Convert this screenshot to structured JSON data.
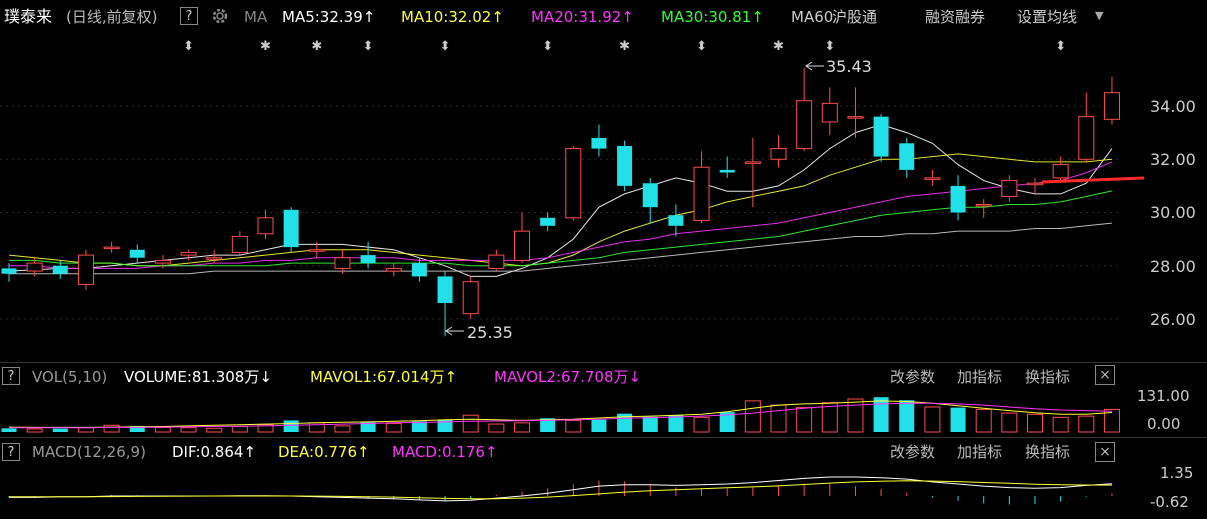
{
  "header": {
    "stock_name": "璞泰来",
    "period_desc": "(日线,前复权)",
    "help": "?",
    "ma_label": "MA",
    "indicators": [
      {
        "label": "MA5:32.39",
        "arrow": "↑",
        "color": "#ffffff"
      },
      {
        "label": "MA10:32.02",
        "arrow": "↑",
        "color": "#ffff33"
      },
      {
        "label": "MA20:31.92",
        "arrow": "↑",
        "color": "#ff33ff"
      },
      {
        "label": "MA30:30.81",
        "arrow": "↑",
        "color": "#33ff33"
      },
      {
        "label": "MA60:",
        "arrow": "",
        "color": "#cccccc"
      }
    ],
    "tabs": [
      "沪股通",
      "融资融券",
      "设置均线"
    ]
  },
  "price_axis": {
    "ticks": [
      "34.00",
      "32.00",
      "30.00",
      "28.00",
      "26.00"
    ]
  },
  "annotations": {
    "high": "35.43",
    "low": "25.35"
  },
  "volume_panel": {
    "help": "?",
    "title": "VOL(5,10)",
    "items": [
      {
        "label": "VOLUME:81.308万",
        "arrow": "↓",
        "color": "#ffffff"
      },
      {
        "label": "MAVOL1:67.014万",
        "arrow": "↑",
        "color": "#ffff33"
      },
      {
        "label": "MAVOL2:67.708万",
        "arrow": "↓",
        "color": "#ff33ff"
      }
    ],
    "actions": [
      "改参数",
      "加指标",
      "换指标"
    ],
    "close": "×",
    "axis": [
      "131.00",
      "0.00"
    ]
  },
  "macd_panel": {
    "help": "?",
    "title": "MACD(12,26,9)",
    "items": [
      {
        "label": "DIF:0.864",
        "arrow": "↑",
        "color": "#ffffff"
      },
      {
        "label": "DEA:0.776",
        "arrow": "↑",
        "color": "#ffff33"
      },
      {
        "label": "MACD:0.176",
        "arrow": "↑",
        "color": "#ff33ff"
      }
    ],
    "actions": [
      "改参数",
      "加指标",
      "换指标"
    ],
    "close": "×",
    "axis": [
      "1.35",
      "-0.62"
    ]
  },
  "event_markers": [
    "⬍",
    "✱",
    "✱",
    "⬍",
    "⬍",
    "⬍",
    "✱",
    "⬍",
    "✱",
    "⬍",
    "⬍"
  ],
  "chart_data": {
    "type": "candlestick",
    "candles": [
      {
        "o": 27.9,
        "c": 27.7,
        "h": 28.1,
        "l": 27.4
      },
      {
        "o": 27.8,
        "c": 28.1,
        "h": 28.3,
        "l": 27.6
      },
      {
        "o": 28.0,
        "c": 27.7,
        "h": 28.2,
        "l": 27.5
      },
      {
        "o": 27.3,
        "c": 28.4,
        "h": 28.6,
        "l": 27.1
      },
      {
        "o": 28.7,
        "c": 28.7,
        "h": 28.9,
        "l": 28.5
      },
      {
        "o": 28.6,
        "c": 28.3,
        "h": 28.8,
        "l": 28.1
      },
      {
        "o": 28.1,
        "c": 28.2,
        "h": 28.4,
        "l": 27.9
      },
      {
        "o": 28.4,
        "c": 28.5,
        "h": 28.6,
        "l": 28.2
      },
      {
        "o": 28.3,
        "c": 28.3,
        "h": 28.6,
        "l": 28.1
      },
      {
        "o": 28.5,
        "c": 29.1,
        "h": 29.3,
        "l": 28.4
      },
      {
        "o": 29.2,
        "c": 29.8,
        "h": 30.1,
        "l": 29.0
      },
      {
        "o": 30.1,
        "c": 28.7,
        "h": 30.2,
        "l": 28.5
      },
      {
        "o": 28.6,
        "c": 28.6,
        "h": 28.9,
        "l": 28.3
      },
      {
        "o": 27.9,
        "c": 28.3,
        "h": 28.6,
        "l": 27.7
      },
      {
        "o": 28.4,
        "c": 28.1,
        "h": 28.9,
        "l": 27.9
      },
      {
        "o": 27.8,
        "c": 27.9,
        "h": 28.1,
        "l": 27.6
      },
      {
        "o": 28.1,
        "c": 27.6,
        "h": 28.3,
        "l": 27.4
      },
      {
        "o": 27.6,
        "c": 26.6,
        "h": 27.8,
        "l": 25.35
      },
      {
        "o": 26.2,
        "c": 27.4,
        "h": 27.6,
        "l": 26.0
      },
      {
        "o": 27.9,
        "c": 28.4,
        "h": 28.6,
        "l": 27.8
      },
      {
        "o": 28.2,
        "c": 29.3,
        "h": 30.0,
        "l": 28.1
      },
      {
        "o": 29.8,
        "c": 29.5,
        "h": 30.0,
        "l": 29.3
      },
      {
        "o": 29.8,
        "c": 32.4,
        "h": 32.5,
        "l": 29.7
      },
      {
        "o": 32.8,
        "c": 32.4,
        "h": 33.3,
        "l": 32.1
      },
      {
        "o": 32.5,
        "c": 31.0,
        "h": 32.7,
        "l": 30.8
      },
      {
        "o": 31.1,
        "c": 30.2,
        "h": 31.3,
        "l": 29.6
      },
      {
        "o": 29.9,
        "c": 29.5,
        "h": 30.3,
        "l": 29.1
      },
      {
        "o": 29.7,
        "c": 31.7,
        "h": 32.3,
        "l": 29.6
      },
      {
        "o": 31.6,
        "c": 31.5,
        "h": 32.1,
        "l": 31.3
      },
      {
        "o": 31.9,
        "c": 31.9,
        "h": 32.8,
        "l": 30.2
      },
      {
        "o": 32.0,
        "c": 32.4,
        "h": 32.9,
        "l": 31.7
      },
      {
        "o": 32.4,
        "c": 34.2,
        "h": 35.43,
        "l": 32.3
      },
      {
        "o": 33.4,
        "c": 34.1,
        "h": 34.7,
        "l": 32.9
      },
      {
        "o": 33.6,
        "c": 33.6,
        "h": 34.7,
        "l": 32.8
      },
      {
        "o": 33.6,
        "c": 32.1,
        "h": 33.7,
        "l": 31.9
      },
      {
        "o": 32.6,
        "c": 31.6,
        "h": 32.8,
        "l": 31.3
      },
      {
        "o": 31.3,
        "c": 31.3,
        "h": 31.6,
        "l": 31.0
      },
      {
        "o": 31.0,
        "c": 30.0,
        "h": 31.4,
        "l": 29.7
      },
      {
        "o": 30.3,
        "c": 30.3,
        "h": 30.5,
        "l": 29.8
      },
      {
        "o": 30.6,
        "c": 31.2,
        "h": 31.4,
        "l": 30.4
      },
      {
        "o": 31.1,
        "c": 31.1,
        "h": 31.3,
        "l": 30.7
      },
      {
        "o": 31.3,
        "c": 31.8,
        "h": 32.1,
        "l": 31.1
      },
      {
        "o": 32.0,
        "c": 33.6,
        "h": 34.5,
        "l": 31.9
      },
      {
        "o": 33.5,
        "c": 34.5,
        "h": 35.1,
        "l": 33.3
      }
    ],
    "ma_lines": [
      {
        "name": "MA5",
        "color": "#ffffff",
        "values": [
          27.8,
          27.85,
          27.9,
          27.9,
          28.0,
          28.1,
          28.2,
          28.3,
          28.4,
          28.4,
          28.6,
          28.8,
          28.8,
          28.8,
          28.7,
          28.6,
          28.3,
          28.0,
          27.6,
          27.6,
          27.9,
          28.3,
          29.0,
          30.2,
          30.7,
          31.0,
          31.3,
          31.1,
          30.8,
          30.8,
          31.0,
          31.6,
          32.4,
          33.0,
          33.3,
          33.0,
          32.6,
          31.8,
          31.2,
          30.9,
          30.7,
          30.7,
          31.1,
          32.4
        ]
      },
      {
        "name": "MA10",
        "color": "#ffff33",
        "values": [
          28.4,
          28.3,
          28.2,
          28.1,
          28.1,
          28.0,
          28.0,
          28.1,
          28.2,
          28.3,
          28.4,
          28.5,
          28.6,
          28.6,
          28.6,
          28.5,
          28.4,
          28.3,
          28.2,
          28.1,
          28.0,
          28.1,
          28.4,
          28.9,
          29.3,
          29.6,
          29.9,
          30.1,
          30.4,
          30.6,
          30.8,
          31.0,
          31.4,
          31.7,
          32.0,
          32.0,
          32.1,
          32.2,
          32.1,
          32.0,
          31.9,
          31.9,
          31.9,
          32.0
        ]
      },
      {
        "name": "MA20",
        "color": "#ff33ff",
        "values": [
          28.0,
          28.0,
          27.9,
          27.9,
          27.9,
          27.9,
          28.0,
          28.0,
          28.1,
          28.1,
          28.2,
          28.2,
          28.3,
          28.3,
          28.3,
          28.3,
          28.2,
          28.2,
          28.2,
          28.2,
          28.2,
          28.3,
          28.5,
          28.7,
          28.9,
          29.0,
          29.2,
          29.3,
          29.4,
          29.5,
          29.6,
          29.8,
          30.0,
          30.2,
          30.4,
          30.6,
          30.7,
          30.8,
          30.9,
          31.0,
          31.1,
          31.2,
          31.5,
          31.9
        ]
      },
      {
        "name": "MA30",
        "color": "#33ff33",
        "values": [
          28.2,
          28.2,
          28.1,
          28.1,
          28.1,
          28.0,
          28.0,
          28.0,
          28.0,
          28.0,
          28.0,
          28.1,
          28.1,
          28.1,
          28.1,
          28.1,
          28.1,
          28.1,
          28.0,
          28.0,
          28.0,
          28.1,
          28.2,
          28.3,
          28.5,
          28.6,
          28.7,
          28.8,
          28.9,
          29.0,
          29.1,
          29.3,
          29.5,
          29.7,
          29.9,
          30.0,
          30.1,
          30.2,
          30.2,
          30.3,
          30.3,
          30.4,
          30.6,
          30.81
        ]
      },
      {
        "name": "MA60",
        "color": "#cccccc",
        "values": [
          27.7,
          27.7,
          27.7,
          27.7,
          27.7,
          27.7,
          27.7,
          27.7,
          27.8,
          27.8,
          27.8,
          27.8,
          27.8,
          27.8,
          27.8,
          27.8,
          27.8,
          27.8,
          27.8,
          27.8,
          27.8,
          27.9,
          28.0,
          28.1,
          28.2,
          28.3,
          28.4,
          28.5,
          28.6,
          28.7,
          28.8,
          28.9,
          29.0,
          29.1,
          29.1,
          29.2,
          29.2,
          29.3,
          29.3,
          29.3,
          29.4,
          29.4,
          29.5,
          29.6
        ]
      }
    ],
    "volume": {
      "max": 131,
      "values": [
        12,
        10,
        11,
        14,
        22,
        20,
        15,
        14,
        12,
        18,
        24,
        38,
        30,
        20,
        32,
        28,
        35,
        40,
        55,
        26,
        30,
        45,
        38,
        40,
        60,
        50,
        55,
        48,
        65,
        102,
        88,
        80,
        96,
        108,
        114,
        104,
        82,
        80,
        74,
        62,
        58,
        48,
        52,
        74,
        64
      ],
      "mavol1": [
        16,
        15,
        15,
        15,
        16,
        17,
        18,
        20,
        22,
        24,
        26,
        28,
        30,
        32,
        33,
        35,
        37,
        40,
        42,
        40,
        38,
        40,
        42,
        46,
        50,
        52,
        55,
        58,
        66,
        78,
        88,
        92,
        94,
        98,
        102,
        100,
        94,
        86,
        78,
        70,
        63,
        58,
        58,
        64,
        67
      ],
      "mavol2": [
        14,
        14,
        14,
        14,
        15,
        15,
        16,
        17,
        18,
        19,
        20,
        22,
        24,
        26,
        28,
        30,
        31,
        33,
        35,
        36,
        37,
        38,
        40,
        42,
        45,
        47,
        49,
        52,
        56,
        62,
        70,
        78,
        84,
        88,
        92,
        94,
        94,
        92,
        88,
        82,
        76,
        72,
        70,
        68,
        68
      ]
    },
    "macd": {
      "dif": [
        -0.1,
        -0.1,
        -0.05,
        -0.05,
        0,
        0,
        0,
        0,
        0,
        0.02,
        0.02,
        0,
        -0.05,
        -0.1,
        -0.15,
        -0.2,
        -0.28,
        -0.35,
        -0.3,
        -0.15,
        0,
        0.2,
        0.45,
        0.7,
        0.8,
        0.8,
        0.75,
        0.8,
        0.85,
        0.95,
        1.1,
        1.25,
        1.35,
        1.35,
        1.3,
        1.2,
        1.0,
        0.85,
        0.7,
        0.6,
        0.55,
        0.6,
        0.75,
        0.864
      ],
      "dea": [
        -0.05,
        -0.05,
        -0.05,
        -0.05,
        -0.04,
        -0.03,
        -0.02,
        -0.01,
        0,
        0,
        0,
        0,
        -0.01,
        -0.03,
        -0.05,
        -0.08,
        -0.12,
        -0.17,
        -0.2,
        -0.19,
        -0.15,
        -0.08,
        0.03,
        0.15,
        0.28,
        0.38,
        0.45,
        0.52,
        0.58,
        0.65,
        0.72,
        0.82,
        0.92,
        1.0,
        1.05,
        1.08,
        1.06,
        1.02,
        0.96,
        0.9,
        0.84,
        0.8,
        0.78,
        0.776
      ],
      "macd": [
        -0.1,
        -0.1,
        0,
        0,
        0.08,
        0.06,
        0.04,
        0.02,
        0,
        0.04,
        0.04,
        0,
        -0.08,
        -0.14,
        -0.2,
        -0.24,
        -0.32,
        -0.36,
        -0.2,
        0.08,
        0.3,
        0.56,
        0.84,
        1.1,
        1.04,
        0.84,
        0.6,
        0.56,
        0.54,
        0.6,
        0.76,
        0.86,
        0.86,
        0.7,
        0.5,
        0.24,
        -0.12,
        -0.34,
        -0.52,
        -0.6,
        -0.58,
        -0.4,
        -0.06,
        0.176
      ]
    },
    "trend_line": {
      "color": "#ff2a2a"
    }
  }
}
